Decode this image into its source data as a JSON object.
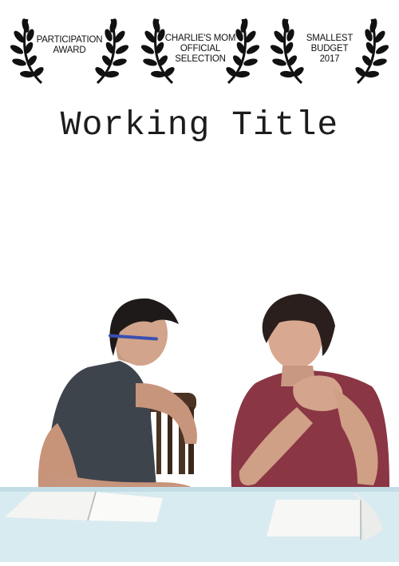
{
  "laurels": [
    {
      "lines": [
        "PARTICIPATION",
        "AWARD"
      ]
    },
    {
      "lines": [
        "CHARLIE'S MOM",
        "OFFICIAL",
        "SELECTION"
      ]
    },
    {
      "lines": [
        "SMALLEST",
        "BUDGET",
        "2017"
      ]
    }
  ],
  "title": "Working Title",
  "colors": {
    "background": "#ffffff",
    "table": "#d8ebf0",
    "shirt_left": "#3e444c",
    "shirt_right": "#8a3644"
  }
}
